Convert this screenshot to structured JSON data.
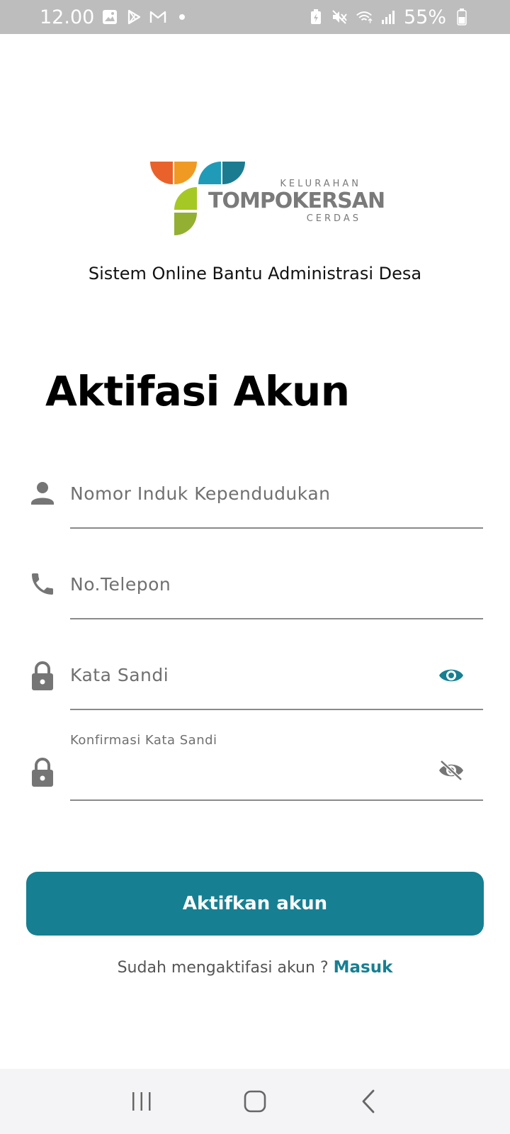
{
  "status_bar": {
    "time": "12.00",
    "battery": "55%",
    "icons": [
      "gallery-icon",
      "play-store-icon",
      "gmail-icon",
      "dot-icon",
      "battery-saver-icon",
      "mute-icon",
      "wifi-icon",
      "signal-icon",
      "battery-icon"
    ]
  },
  "logo": {
    "line1": "KELURAHAN",
    "line2": "TOMPOKERSAN",
    "line3": "CERDAS",
    "colors": [
      "#e9622b",
      "#f09a24",
      "#1f9bb8",
      "#1b7c91",
      "#a6c824",
      "#93b033"
    ]
  },
  "tagline": "Sistem Online Bantu Administrasi Desa",
  "title": "Aktifasi Akun",
  "form": {
    "nik": {
      "placeholder": "Nomor Induk Kependudukan",
      "value": ""
    },
    "phone": {
      "placeholder": "No.Telepon",
      "value": ""
    },
    "password": {
      "placeholder": "Kata Sandi",
      "value": ""
    },
    "confirm_password": {
      "label": "Konfirmasi Kata Sandi",
      "value": ""
    }
  },
  "submit_label": "Aktifkan akun",
  "footer": {
    "question": "Sudah mengaktifasi akun ? ",
    "link": "Masuk"
  },
  "colors": {
    "accent": "#177f92",
    "icon_gray": "#757575",
    "status_bar": "#bdbdbd"
  }
}
